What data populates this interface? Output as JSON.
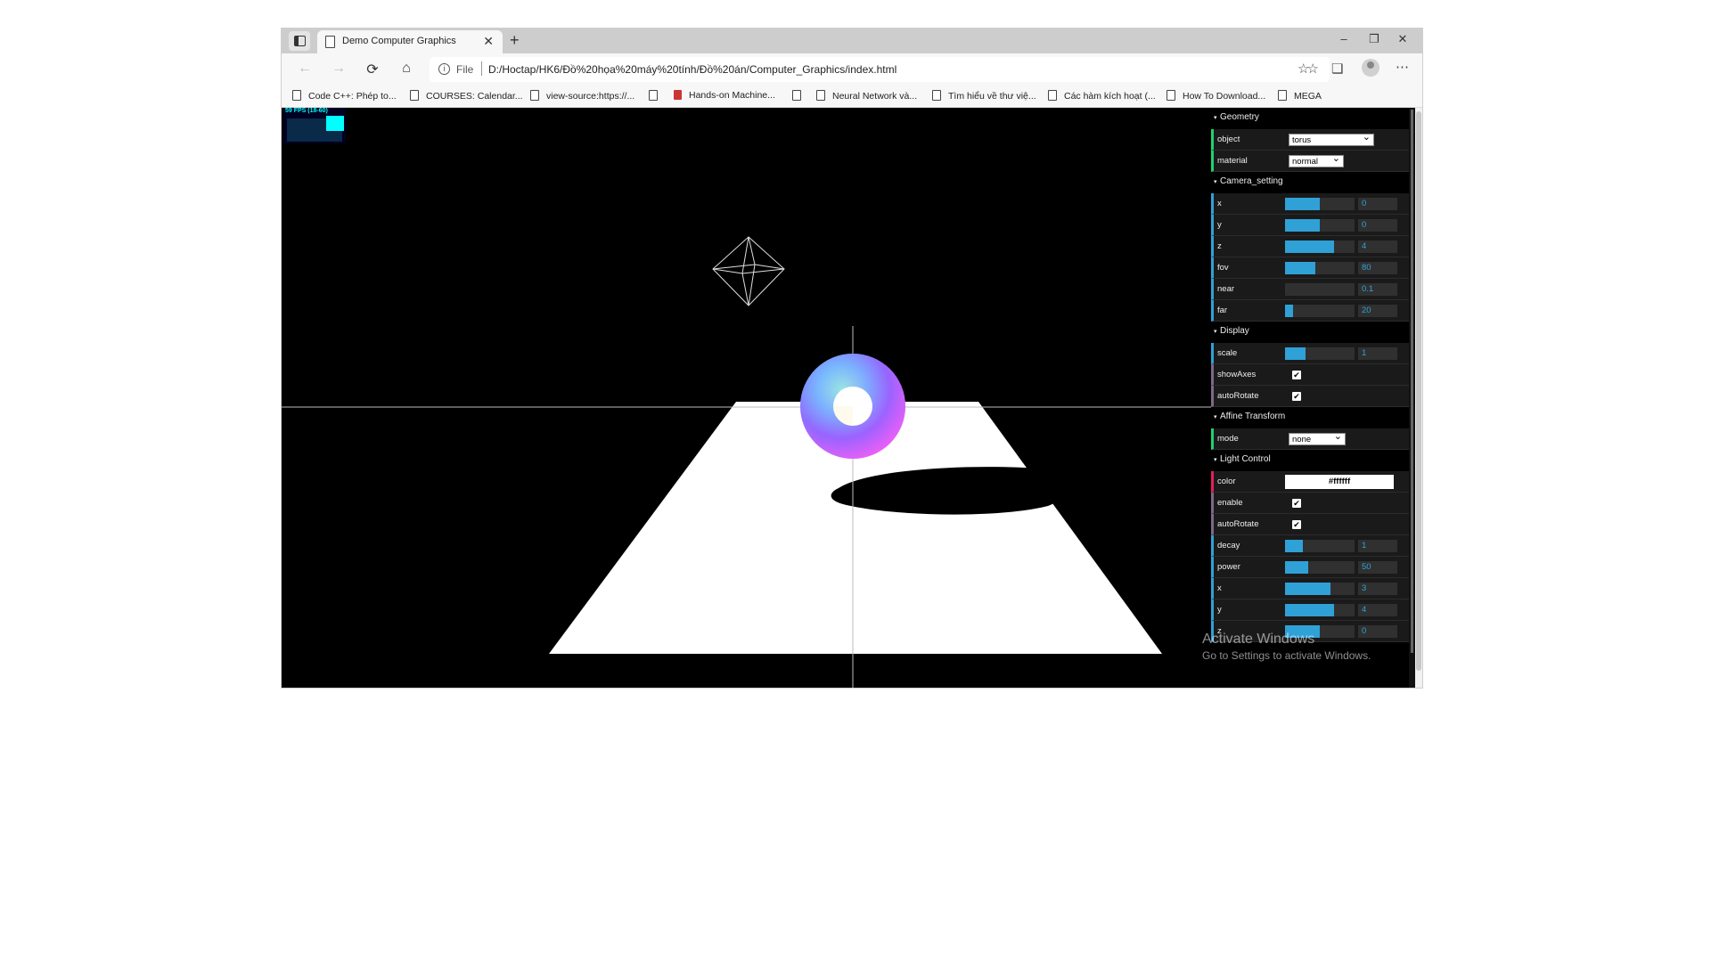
{
  "tab": {
    "title": "Demo Computer Graphics"
  },
  "address": {
    "scheme_label": "File",
    "url": "D:/Hoctap/HK6/Đồ%20họa%20máy%20tính/Đồ%20án/Computer_Graphics/index.html"
  },
  "bookmarks": [
    "Code C++: Phép to...",
    "COURSES: Calendar...",
    "view-source:https://...",
    "Hands-on Machine...",
    "Neural Network và...",
    "Tìm hiểu về thư việ...",
    "Các hàm kích hoạt (...",
    "How To Download...",
    "MEGA"
  ],
  "stats": {
    "fps": "59 FPS (18-60)"
  },
  "gui": {
    "geometry": {
      "title": "Geometry",
      "object_label": "object",
      "object_value": "torus",
      "material_label": "material",
      "material_value": "normal"
    },
    "camera": {
      "title": "Camera_setting",
      "x": {
        "label": "x",
        "value": "0",
        "fraction": 0.5
      },
      "y": {
        "label": "y",
        "value": "0",
        "fraction": 0.5
      },
      "z": {
        "label": "z",
        "value": "4",
        "fraction": 0.7
      },
      "fov": {
        "label": "fov",
        "value": "80",
        "fraction": 0.44
      },
      "near": {
        "label": "near",
        "value": "0.1",
        "fraction": 0.0
      },
      "far": {
        "label": "far",
        "value": "20",
        "fraction": 0.12
      }
    },
    "display": {
      "title": "Display",
      "scale": {
        "label": "scale",
        "value": "1",
        "fraction": 0.3
      },
      "showAxes": {
        "label": "showAxes",
        "checked": true
      },
      "autoRotate": {
        "label": "autoRotate",
        "checked": true
      }
    },
    "affine": {
      "title": "Affine Transform",
      "mode_label": "mode",
      "mode_value": "none"
    },
    "light": {
      "title": "Light Control",
      "color": {
        "label": "color",
        "value": "#ffffff"
      },
      "enable": {
        "label": "enable",
        "checked": true
      },
      "autoRotate": {
        "label": "autoRotate",
        "checked": true
      },
      "decay": {
        "label": "decay",
        "value": "1",
        "fraction": 0.25
      },
      "power": {
        "label": "power",
        "value": "50",
        "fraction": 0.33
      },
      "x": {
        "label": "x",
        "value": "3",
        "fraction": 0.65
      },
      "y": {
        "label": "y",
        "value": "4",
        "fraction": 0.7
      },
      "z": {
        "label": "z",
        "value": "0",
        "fraction": 0.5
      }
    }
  },
  "watermark": {
    "line1": "Activate Windows",
    "line2": "Go to Settings to activate Windows."
  },
  "check_glyph": "✔"
}
